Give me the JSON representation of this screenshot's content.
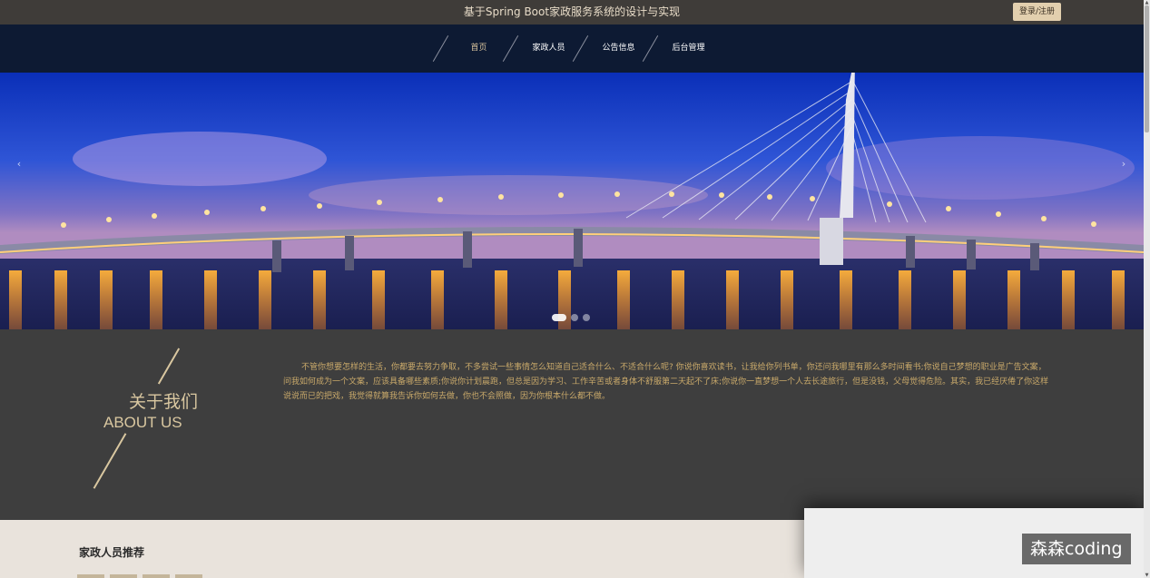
{
  "header": {
    "title": "基于Spring Boot家政服务系统的设计与实现",
    "login_label": "登录/注册"
  },
  "nav": {
    "items": [
      {
        "label": "首页",
        "active": true
      },
      {
        "label": "家政人员",
        "active": false
      },
      {
        "label": "公告信息",
        "active": false
      },
      {
        "label": "后台管理",
        "active": false
      }
    ]
  },
  "banner": {
    "prev_icon": "chevron-left-icon",
    "next_icon": "chevron-right-icon",
    "slide_count": 3,
    "active_slide": 1
  },
  "about": {
    "title_cn": "关于我们",
    "title_en": "ABOUT US",
    "text": "不管你想要怎样的生活，你都要去努力争取，不多尝试一些事情怎么知道自己适合什么、不适合什么呢? 你说你喜欢读书，让我给你列书单，你还问我哪里有那么多时间看书;你说自己梦想的职业是广告文案，问我如何成为一个文案，应该具备哪些素质;你说你计划晨跑，但总是因为学习、工作辛苦或者身体不舒服第二天起不了床;你说你一直梦想一个人去长途旅行，但是没钱，父母觉得危险。其实，我已经厌倦了你这样说说而已的把戏，我觉得就算我告诉你如何去做，你也不会照做，因为你根本什么都不做。"
  },
  "staff": {
    "title": "家政人员推荐"
  },
  "watermark": "森森coding",
  "colors": {
    "topbar": "#3f3c39",
    "navbar": "#0d1a33",
    "accent_gold": "#d9c7a0",
    "about_bg": "#3e3e3e"
  }
}
